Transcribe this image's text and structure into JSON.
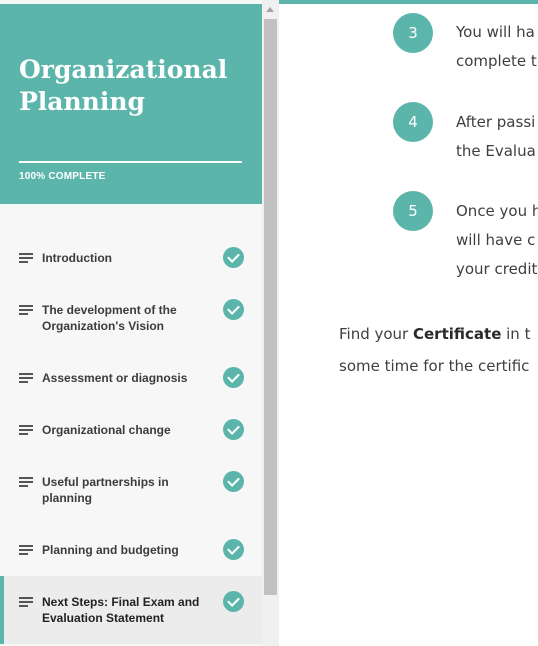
{
  "sidebar": {
    "title": "Organizational Planning",
    "progress_label": "100% COMPLETE",
    "progress_percent": 100,
    "lessons": [
      {
        "label": "Introduction",
        "completed": true,
        "active": false
      },
      {
        "label": "The development of the Organization's Vision",
        "completed": true,
        "active": false
      },
      {
        "label": "Assessment or diagnosis",
        "completed": true,
        "active": false
      },
      {
        "label": "Organizational change",
        "completed": true,
        "active": false
      },
      {
        "label": "Useful partnerships in planning",
        "completed": true,
        "active": false
      },
      {
        "label": "Planning and budgeting",
        "completed": true,
        "active": false
      },
      {
        "label": "Next Steps: Final Exam and Evaluation Statement",
        "completed": true,
        "active": true
      }
    ],
    "lesson_icon": "hamburger-list-icon",
    "check_icon": "check-circle-icon"
  },
  "content": {
    "steps": [
      {
        "number": "3",
        "lines": [
          "You will ha",
          "complete t"
        ]
      },
      {
        "number": "4",
        "lines": [
          "After passi",
          "the Evalua"
        ]
      },
      {
        "number": "5",
        "lines": [
          "Once you h",
          "will have c",
          "your credit"
        ]
      }
    ],
    "footer": {
      "line1_prefix": "Find your ",
      "line1_bold": "Certificate",
      "line1_suffix": " in t",
      "line2": "some time for the certific"
    }
  },
  "colors": {
    "accent": "#5bb5aa",
    "sidebar_bg": "#f7f7f7",
    "text": "#3f3f3f"
  }
}
